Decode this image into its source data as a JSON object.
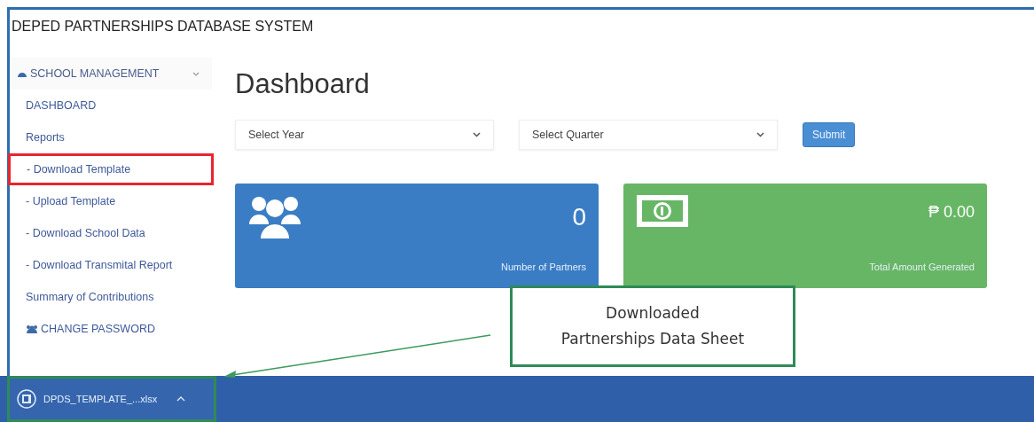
{
  "app_title": "DEPED PARTNERSHIPS DATABASE SYSTEM",
  "sidebar": {
    "items": [
      {
        "kind": "section",
        "label": "SCHOOL MANAGEMENT",
        "expanded": true
      },
      {
        "kind": "link",
        "label": "DASHBOARD",
        "highlighted": false
      },
      {
        "kind": "link",
        "label": "Reports",
        "highlighted": false
      },
      {
        "kind": "subitem",
        "label": "- Download Template",
        "highlighted": true
      },
      {
        "kind": "subitem",
        "label": "- Upload Template",
        "highlighted": false
      },
      {
        "kind": "subitem",
        "label": "- Download School Data",
        "highlighted": false
      },
      {
        "kind": "subitem",
        "label": "- Download Transmital Report",
        "highlighted": false
      },
      {
        "kind": "link",
        "label": "Summary of Contributions",
        "highlighted": false
      },
      {
        "kind": "account",
        "label": "CHANGE PASSWORD"
      }
    ]
  },
  "page_title": "Dashboard",
  "filters": [
    {
      "placeholder": "Select Year"
    },
    {
      "placeholder": "Select Quarter"
    }
  ],
  "submit_button": "Submit",
  "cards": [
    {
      "kind": "partners",
      "color": "#3a7dc4",
      "value": "0",
      "label": "Number of Partners"
    },
    {
      "kind": "money",
      "color": "#67b665",
      "value": "₱ 0.00",
      "label": "Total Amount Generated"
    }
  ],
  "callout": "Downloaded\nPartnerships Data Sheet",
  "download_bar": {
    "file": "DPDS_TEMPLATE_...xlsx",
    "highlighted": true
  }
}
